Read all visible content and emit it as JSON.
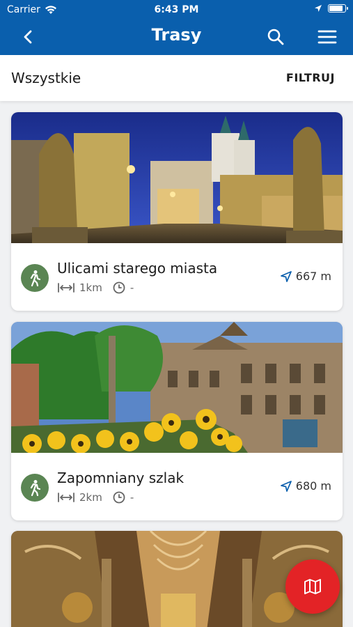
{
  "status_bar": {
    "carrier": "Carrier",
    "time": "6:43 PM"
  },
  "navbar": {
    "title": "Trasy"
  },
  "toolbar": {
    "all_label": "Wszystkie",
    "filter_label": "FILTRUJ"
  },
  "routes": [
    {
      "name": "Ulicami starego miasta",
      "length": "1km",
      "duration": "-",
      "distance": "667 m"
    },
    {
      "name": "Zapomniany szlak",
      "length": "2km",
      "duration": "-",
      "distance": "680 m"
    }
  ],
  "colors": {
    "brand": "#0a5fad",
    "walk_badge": "#5a8553",
    "fab": "#e32326",
    "accent_arrow": "#0a5fad"
  },
  "icons": [
    "back-icon",
    "search-icon",
    "menu-icon",
    "walk-icon",
    "length-icon",
    "clock-icon",
    "location-arrow-icon",
    "map-icon"
  ]
}
